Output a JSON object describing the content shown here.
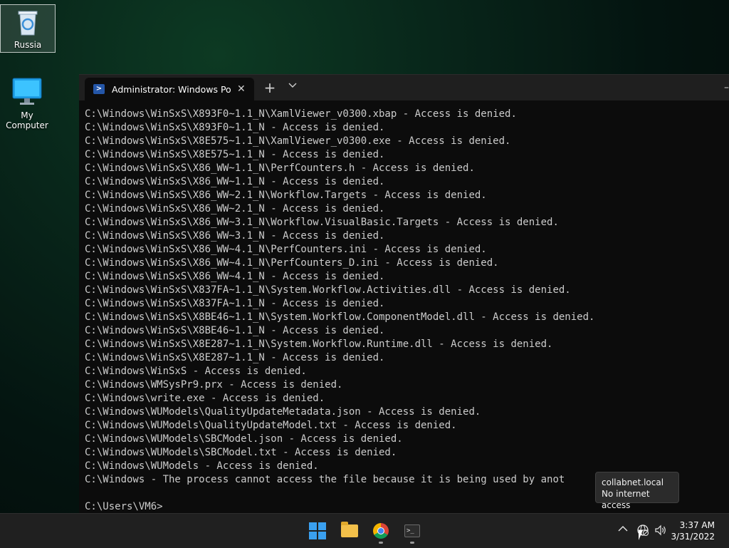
{
  "desktop": {
    "icons": [
      {
        "label": "Russia",
        "icon": "recycle-bin-icon"
      },
      {
        "label": "My Computer",
        "icon": "monitor-icon"
      }
    ]
  },
  "terminal": {
    "tab_title": "Administrator: Windows PowerS",
    "tab_icon": "powershell-icon",
    "new_tab_label": "+",
    "dropdown_label": "⌄",
    "lines": [
      "C:\\Windows\\WinSxS\\X893F0~1.1_N\\XamlViewer_v0300.xbap - Access is denied.",
      "C:\\Windows\\WinSxS\\X893F0~1.1_N - Access is denied.",
      "C:\\Windows\\WinSxS\\X8E575~1.1_N\\XamlViewer_v0300.exe - Access is denied.",
      "C:\\Windows\\WinSxS\\X8E575~1.1_N - Access is denied.",
      "C:\\Windows\\WinSxS\\X86_WW~1.1_N\\PerfCounters.h - Access is denied.",
      "C:\\Windows\\WinSxS\\X86_WW~1.1_N - Access is denied.",
      "C:\\Windows\\WinSxS\\X86_WW~2.1_N\\Workflow.Targets - Access is denied.",
      "C:\\Windows\\WinSxS\\X86_WW~2.1_N - Access is denied.",
      "C:\\Windows\\WinSxS\\X86_WW~3.1_N\\Workflow.VisualBasic.Targets - Access is denied.",
      "C:\\Windows\\WinSxS\\X86_WW~3.1_N - Access is denied.",
      "C:\\Windows\\WinSxS\\X86_WW~4.1_N\\PerfCounters.ini - Access is denied.",
      "C:\\Windows\\WinSxS\\X86_WW~4.1_N\\PerfCounters_D.ini - Access is denied.",
      "C:\\Windows\\WinSxS\\X86_WW~4.1_N - Access is denied.",
      "C:\\Windows\\WinSxS\\X837FA~1.1_N\\System.Workflow.Activities.dll - Access is denied.",
      "C:\\Windows\\WinSxS\\X837FA~1.1_N - Access is denied.",
      "C:\\Windows\\WinSxS\\X8BE46~1.1_N\\System.Workflow.ComponentModel.dll - Access is denied.",
      "C:\\Windows\\WinSxS\\X8BE46~1.1_N - Access is denied.",
      "C:\\Windows\\WinSxS\\X8E287~1.1_N\\System.Workflow.Runtime.dll - Access is denied.",
      "C:\\Windows\\WinSxS\\X8E287~1.1_N - Access is denied.",
      "C:\\Windows\\WinSxS - Access is denied.",
      "C:\\Windows\\WMSysPr9.prx - Access is denied.",
      "C:\\Windows\\write.exe - Access is denied.",
      "C:\\Windows\\WUModels\\QualityUpdateMetadata.json - Access is denied.",
      "C:\\Windows\\WUModels\\QualityUpdateModel.txt - Access is denied.",
      "C:\\Windows\\WUModels\\SBCModel.json - Access is denied.",
      "C:\\Windows\\WUModels\\SBCModel.txt - Access is denied.",
      "C:\\Windows\\WUModels - Access is denied.",
      "C:\\Windows - The process cannot access the file because it is being used by anot",
      "",
      "C:\\Users\\VM6>"
    ]
  },
  "taskbar": {
    "apps": [
      {
        "name": "start-button",
        "icon": "windows-logo-icon"
      },
      {
        "name": "file-explorer-button",
        "icon": "folder-icon"
      },
      {
        "name": "chrome-button",
        "icon": "chrome-icon"
      },
      {
        "name": "terminal-button",
        "icon": "terminal-icon"
      }
    ],
    "tray": {
      "overflow_icon": "chevron-up-icon",
      "network_icon": "globe-no-internet-icon",
      "volume_icon": "speaker-icon"
    },
    "clock": {
      "time": "3:37 AM",
      "date": "3/31/2022"
    }
  },
  "tooltip": {
    "line1": "collabnet.local",
    "line2": "No internet access"
  },
  "colors": {
    "terminal_bg": "#0c0c0c",
    "terminal_text": "#cccccc",
    "taskbar_bg": "#202020",
    "accent": "#3aa0f0"
  }
}
